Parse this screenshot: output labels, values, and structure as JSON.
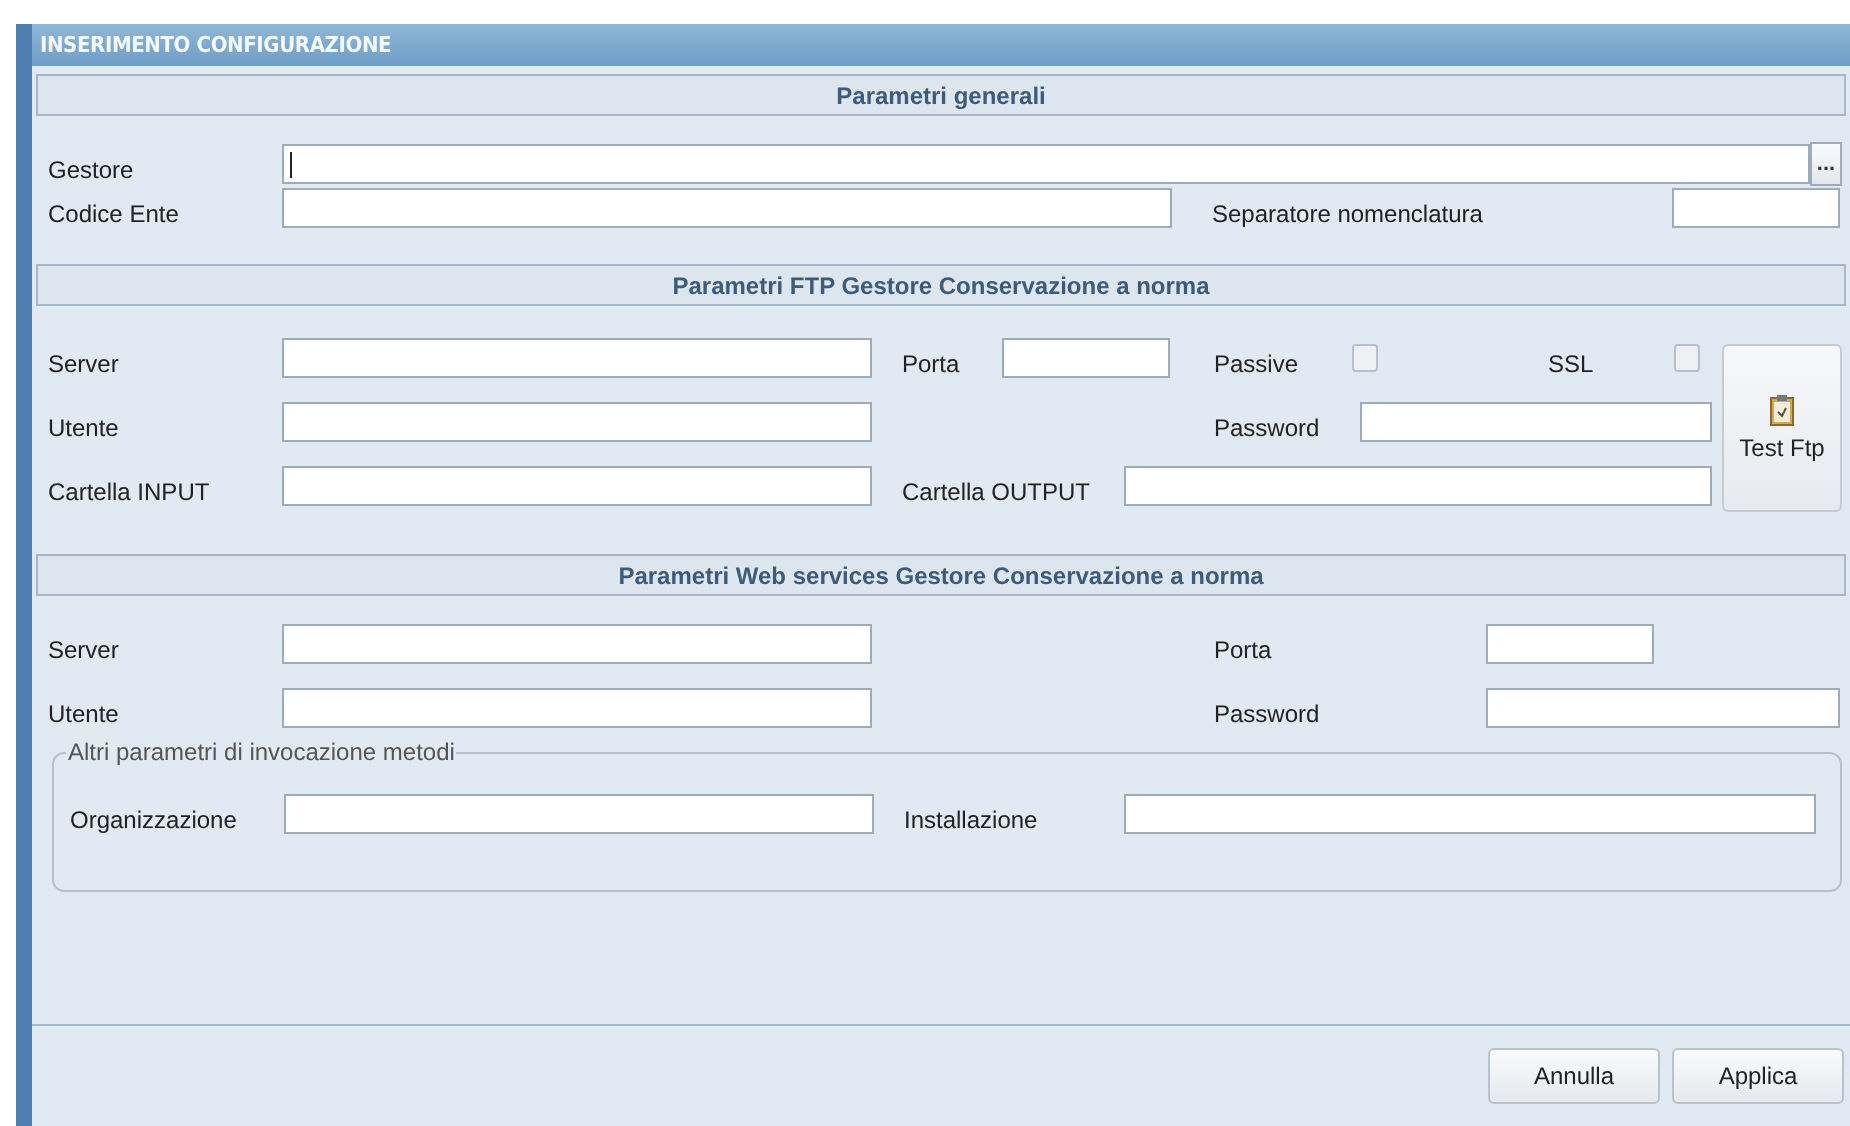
{
  "window": {
    "title": "INSERIMENTO CONFIGURAZIONE"
  },
  "general": {
    "heading": "Parametri generali",
    "gestore": {
      "label": "Gestore",
      "focused": true,
      "browse": "..."
    },
    "codice_ente": {
      "label": "Codice Ente"
    },
    "separatore": {
      "label": "Separatore nomenclatura"
    }
  },
  "ftp": {
    "heading": "Parametri FTP Gestore Conservazione a norma",
    "server": {
      "label": "Server"
    },
    "porta": {
      "label": "Porta"
    },
    "passive": {
      "label": "Passive",
      "checked": false
    },
    "ssl": {
      "label": "SSL",
      "checked": false
    },
    "utente": {
      "label": "Utente"
    },
    "password": {
      "label": "Password"
    },
    "cartella_input": {
      "label": "Cartella INPUT"
    },
    "cartella_output": {
      "label": "Cartella OUTPUT"
    },
    "test_button": {
      "label": "Test Ftp"
    }
  },
  "web_services": {
    "heading": "Parametri Web services Gestore Conservazione a norma",
    "server": {
      "label": "Server"
    },
    "porta": {
      "label": "Porta"
    },
    "utente": {
      "label": "Utente"
    },
    "password": {
      "label": "Password"
    },
    "group": {
      "legend": "Altri parametri di invocazione metodi",
      "organizzazione": {
        "label": "Organizzazione"
      },
      "installazione": {
        "label": "Installazione"
      }
    }
  },
  "buttons": [
    {
      "label": "Annulla"
    },
    {
      "label": "Applica"
    }
  ]
}
